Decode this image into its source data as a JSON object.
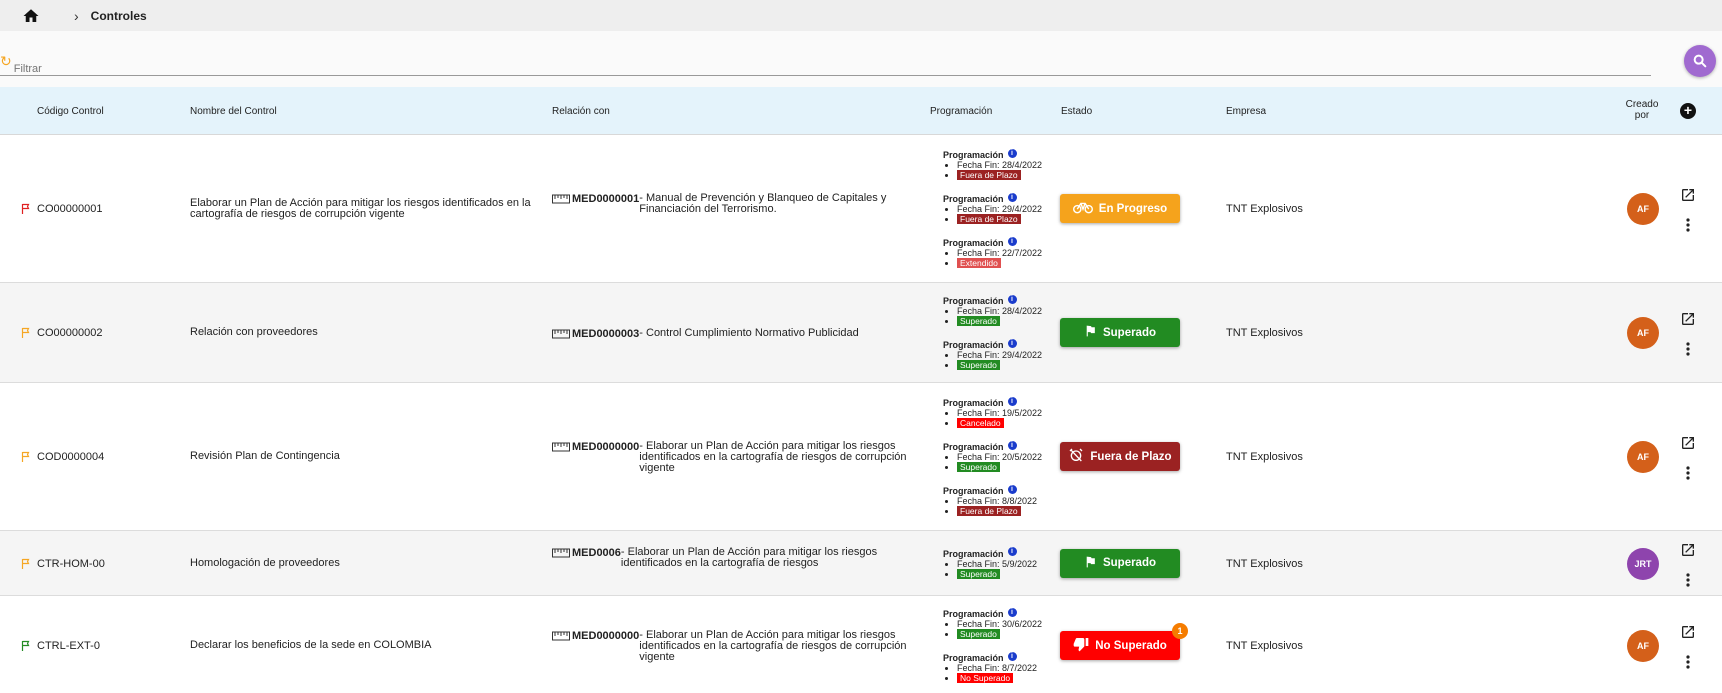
{
  "breadcrumb": {
    "current": "Controles"
  },
  "filter": {
    "placeholder": "Filtrar"
  },
  "columns": {
    "codigo": "Código Control",
    "nombre": "Nombre del Control",
    "relacion": "Relación con",
    "programacion": "Programación",
    "estado": "Estado",
    "empresa": "Empresa",
    "creado": "Creado por"
  },
  "colors": {
    "header_bg": "#e4f3fb",
    "search_button": "#a06ad0",
    "en_progreso": "#f5a31c",
    "superado": "#228b22",
    "fuera_de_plazo": "#9b2222",
    "no_superado": "#ff0000",
    "cancelado": "#ff0000",
    "extendido": "#e05050"
  },
  "rows": [
    {
      "code": "CO00000001",
      "flag": "#e02020",
      "name": "Elaborar un Plan de Acción para mitigar los riesgos identificados en la cartografía de riesgos de corrupción vigente",
      "med": "MED0000001",
      "rel_desc": "- Manual de Prevención y Blanqueo de Capitales y Financiación del Terrorismo.",
      "programaciones": [
        {
          "title": "Programación",
          "fecha": "Fecha Fin: 28/4/2022",
          "tag": "Fuera de Plazo",
          "tag_color": "#9b2222"
        },
        {
          "title": "Programación",
          "fecha": "Fecha Fin: 29/4/2022",
          "tag": "Fuera de Plazo",
          "tag_color": "#9b2222"
        },
        {
          "title": "Programación",
          "fecha": "Fecha Fin: 22/7/2022",
          "tag": "Extendido",
          "tag_color": "#e05050"
        }
      ],
      "estado": "En Progreso",
      "estado_icon": "bicycle-icon",
      "estado_color": "#f5a31c",
      "empresa": "TNT Explosivos",
      "avatar": "AF",
      "avatar_color": "#d4601a"
    },
    {
      "code": "CO00000002",
      "flag": "#f5a623",
      "name": "Relación con proveedores",
      "med": "MED0000003",
      "rel_desc": "- Control Cumplimiento Normativo Publicidad",
      "programaciones": [
        {
          "title": "Programación",
          "fecha": "Fecha Fin: 28/4/2022",
          "tag": "Superado",
          "tag_color": "#228b22"
        },
        {
          "title": "Programación",
          "fecha": "Fecha Fin: 29/4/2022",
          "tag": "Superado",
          "tag_color": "#228b22"
        }
      ],
      "estado": "Superado",
      "estado_icon": "flag-icon",
      "estado_color": "#228b22",
      "empresa": "TNT Explosivos",
      "avatar": "AF",
      "avatar_color": "#d4601a"
    },
    {
      "code": "COD0000004",
      "flag": "#f5a623",
      "name": "Revisión Plan de Contingencia",
      "med": "MED0000000",
      "rel_desc": "- Elaborar un Plan de Acción para mitigar los riesgos identificados en la cartografía de riesgos de corrupción vigente",
      "programaciones": [
        {
          "title": "Programación",
          "fecha": "Fecha Fin: 19/5/2022",
          "tag": "Cancelado",
          "tag_color": "#ff0000"
        },
        {
          "title": "Programación",
          "fecha": "Fecha Fin: 20/5/2022",
          "tag": "Superado",
          "tag_color": "#228b22"
        },
        {
          "title": "Programación",
          "fecha": "Fecha Fin: 8/8/2022",
          "tag": "Fuera de Plazo",
          "tag_color": "#9b2222"
        }
      ],
      "estado": "Fuera de Plazo",
      "estado_icon": "alarm-off-icon",
      "estado_color": "#9b2222",
      "empresa": "TNT Explosivos",
      "avatar": "AF",
      "avatar_color": "#d4601a"
    },
    {
      "code": "CTR-HOM-00",
      "flag": "#f5a623",
      "name": "Homologación de proveedores",
      "med": "MED0006",
      "rel_desc": "- Elaborar un Plan de Acción para mitigar los riesgos identificados en la cartografía de riesgos",
      "programaciones": [
        {
          "title": "Programación",
          "fecha": "Fecha Fin: 5/9/2022",
          "tag": "Superado",
          "tag_color": "#228b22"
        }
      ],
      "estado": "Superado",
      "estado_icon": "flag-icon",
      "estado_color": "#228b22",
      "empresa": "TNT Explosivos",
      "avatar": "JRT",
      "avatar_color": "#8e44ad"
    },
    {
      "code": "CTRL-EXT-0",
      "flag": "#228b22",
      "name": "Declarar los beneficios de la sede en COLOMBIA",
      "med": "MED0000000",
      "rel_desc": "- Elaborar un Plan de Acción para mitigar los riesgos identificados en la cartografía de riesgos de corrupción vigente",
      "programaciones": [
        {
          "title": "Programación",
          "fecha": "Fecha Fin: 30/6/2022",
          "tag": "Superado",
          "tag_color": "#228b22"
        },
        {
          "title": "Programación",
          "fecha": "Fecha Fin: 8/7/2022",
          "tag": "No Superado",
          "tag_color": "#ff0000"
        }
      ],
      "estado": "No Superado",
      "estado_icon": "thumbs-down-icon",
      "estado_color": "#ff0000",
      "estado_badge": "1",
      "empresa": "TNT Explosivos",
      "avatar": "AF",
      "avatar_color": "#d4601a"
    }
  ]
}
